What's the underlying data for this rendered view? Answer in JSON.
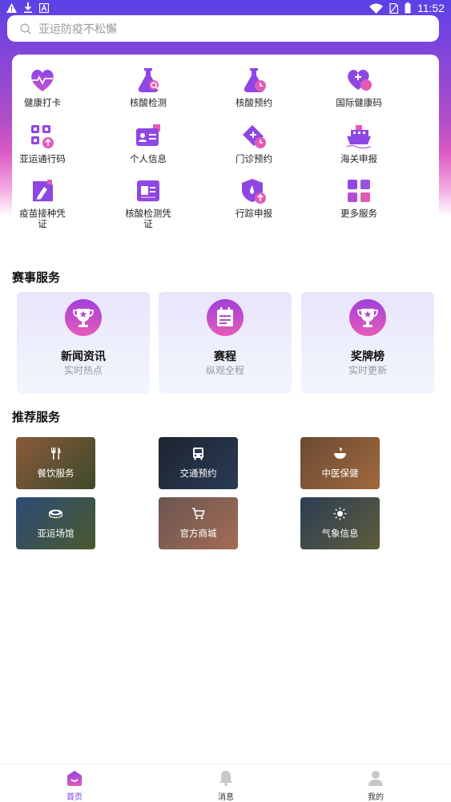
{
  "status_bar": {
    "time": "11:52",
    "icons": [
      "warning-icon",
      "download-icon",
      "a-badge-icon",
      "wifi-icon",
      "no-sim-icon",
      "battery-icon"
    ]
  },
  "search": {
    "placeholder": "亚运防疫不松懈",
    "icon": "search-icon"
  },
  "quick_services": [
    {
      "label": "健康打卡",
      "icon": "heart-monitor-icon"
    },
    {
      "label": "核酸检测",
      "icon": "flask-search-icon"
    },
    {
      "label": "核酸预约",
      "icon": "flask-clock-icon"
    },
    {
      "label": "国际健康码",
      "icon": "heart-plus-icon"
    },
    {
      "label": "亚运通行码",
      "icon": "qr-upload-icon"
    },
    {
      "label": "个人信息",
      "icon": "id-card-icon"
    },
    {
      "label": "门诊预约",
      "icon": "medical-tag-clock-icon"
    },
    {
      "label": "海关申报",
      "icon": "ship-icon"
    },
    {
      "label": "疫苗接种凭证",
      "icon": "certificate-pen-icon"
    },
    {
      "label": "核酸检测凭证",
      "icon": "certificate-card-icon"
    },
    {
      "label": "行踪申报",
      "icon": "shield-upload-icon"
    },
    {
      "label": "更多服务",
      "icon": "grid-icon"
    }
  ],
  "events_section": {
    "title": "赛事服务",
    "cards": [
      {
        "title": "新闻资讯",
        "subtitle": "实时热点",
        "icon": "trophy-star-icon"
      },
      {
        "title": "赛程",
        "subtitle": "纵观全程",
        "icon": "calendar-icon"
      },
      {
        "title": "奖牌榜",
        "subtitle": "实时更新",
        "icon": "medal-trophy-icon"
      }
    ]
  },
  "recommend_section": {
    "title": "推荐服务",
    "tiles": [
      {
        "label": "餐饮服务",
        "icon": "fork-knife-icon",
        "bg": [
          "#8a5a3a",
          "#3d4a2a"
        ]
      },
      {
        "label": "交通预约",
        "icon": "bus-icon",
        "bg": [
          "#1d2430",
          "#2a3b55"
        ]
      },
      {
        "label": "中医保健",
        "icon": "herbal-bowl-icon",
        "bg": [
          "#6b4a32",
          "#a0693e"
        ]
      },
      {
        "label": "亚运场馆",
        "icon": "stadium-icon",
        "bg": [
          "#2d4a78",
          "#4a5a2c"
        ]
      },
      {
        "label": "官方商城",
        "icon": "cart-icon",
        "bg": [
          "#6a5550",
          "#a56c55"
        ]
      },
      {
        "label": "气象信息",
        "icon": "sun-icon",
        "bg": [
          "#2d3e55",
          "#5d5c3c"
        ]
      }
    ]
  },
  "bottom_nav": {
    "items": [
      {
        "label": "首页",
        "icon": "home-icon",
        "active": true
      },
      {
        "label": "消息",
        "icon": "bell-icon",
        "active": false
      },
      {
        "label": "我的",
        "icon": "user-icon",
        "active": false
      }
    ]
  },
  "colors": {
    "accent_purple": "#7b3fe4",
    "accent_pink": "#e85bb8",
    "header_top": "#5b41e6",
    "header_mid": "#dc59c3"
  }
}
